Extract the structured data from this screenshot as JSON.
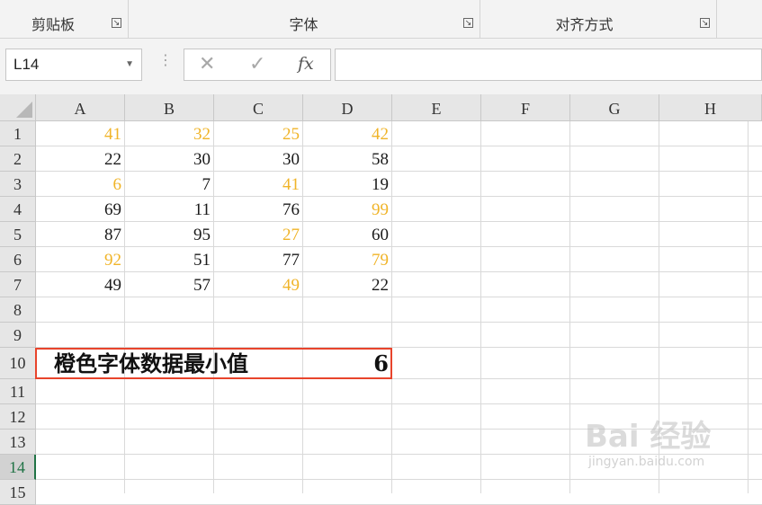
{
  "ribbon": {
    "groups": [
      {
        "label": "剪贴板"
      },
      {
        "label": "字体"
      },
      {
        "label": "对齐方式"
      }
    ],
    "launcher_glyph": "↘"
  },
  "formula_bar": {
    "name_box": "L14",
    "cancel_glyph": "✕",
    "enter_glyph": "✓",
    "fx_label": "fx",
    "formula": ""
  },
  "columns": [
    "A",
    "B",
    "C",
    "D",
    "E",
    "F",
    "G",
    "H"
  ],
  "rows": [
    "1",
    "2",
    "3",
    "4",
    "5",
    "6",
    "7",
    "8",
    "9",
    "10",
    "11",
    "12",
    "13",
    "14",
    "15"
  ],
  "selected_row": "14",
  "cells": [
    [
      {
        "v": "41",
        "c": "orange"
      },
      {
        "v": "32",
        "c": "orange"
      },
      {
        "v": "25",
        "c": "orange"
      },
      {
        "v": "42",
        "c": "orange"
      }
    ],
    [
      {
        "v": "22",
        "c": "black"
      },
      {
        "v": "30",
        "c": "black"
      },
      {
        "v": "30",
        "c": "black"
      },
      {
        "v": "58",
        "c": "black"
      }
    ],
    [
      {
        "v": "6",
        "c": "orange"
      },
      {
        "v": "7",
        "c": "black"
      },
      {
        "v": "41",
        "c": "orange"
      },
      {
        "v": "19",
        "c": "black"
      }
    ],
    [
      {
        "v": "69",
        "c": "black"
      },
      {
        "v": "11",
        "c": "black"
      },
      {
        "v": "76",
        "c": "black"
      },
      {
        "v": "99",
        "c": "orange"
      }
    ],
    [
      {
        "v": "87",
        "c": "black"
      },
      {
        "v": "95",
        "c": "black"
      },
      {
        "v": "27",
        "c": "orange"
      },
      {
        "v": "60",
        "c": "black"
      }
    ],
    [
      {
        "v": "92",
        "c": "orange"
      },
      {
        "v": "51",
        "c": "black"
      },
      {
        "v": "77",
        "c": "black"
      },
      {
        "v": "79",
        "c": "orange"
      }
    ],
    [
      {
        "v": "49",
        "c": "black"
      },
      {
        "v": "57",
        "c": "black"
      },
      {
        "v": "49",
        "c": "orange"
      },
      {
        "v": "22",
        "c": "black"
      }
    ]
  ],
  "result": {
    "label": "橙色字体数据最小值",
    "value": "6"
  },
  "colors": {
    "orange_text": "#f0b428",
    "highlight_border": "#e8442c",
    "selected_row_accent": "#217346"
  },
  "watermark": {
    "main": "Bai 经验",
    "sub": "jingyan.baidu.com"
  }
}
